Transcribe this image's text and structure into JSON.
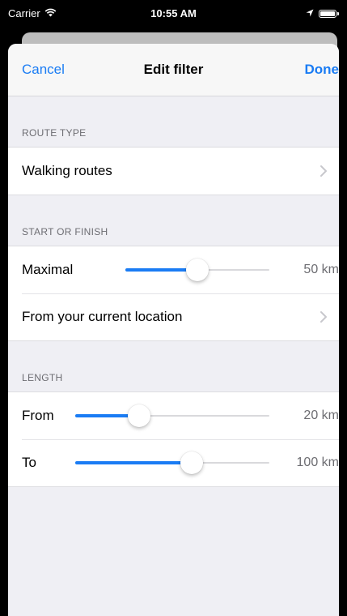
{
  "status_bar": {
    "carrier": "Carrier",
    "time": "10:55 AM",
    "icons": [
      "wifi-icon",
      "location-arrow-icon",
      "battery-icon"
    ]
  },
  "navbar": {
    "cancel_label": "Cancel",
    "title": "Edit filter",
    "done_label": "Done"
  },
  "sections": {
    "route_type": {
      "header": "ROUTE TYPE",
      "value": "Walking routes"
    },
    "start_finish": {
      "header": "START OR FINISH",
      "maximal_label": "Maximal",
      "maximal_value": "50 km",
      "maximal_fraction": 0.5,
      "location_label": "From your current location"
    },
    "length": {
      "header": "LENGTH",
      "from_label": "From",
      "from_value": "20 km",
      "from_fraction": 0.33,
      "to_label": "To",
      "to_value": "100 km",
      "to_fraction": 0.6
    }
  },
  "colors": {
    "accent": "#1a7cf4",
    "group_background": "#efeff4",
    "secondary_text": "#6d6d72"
  }
}
